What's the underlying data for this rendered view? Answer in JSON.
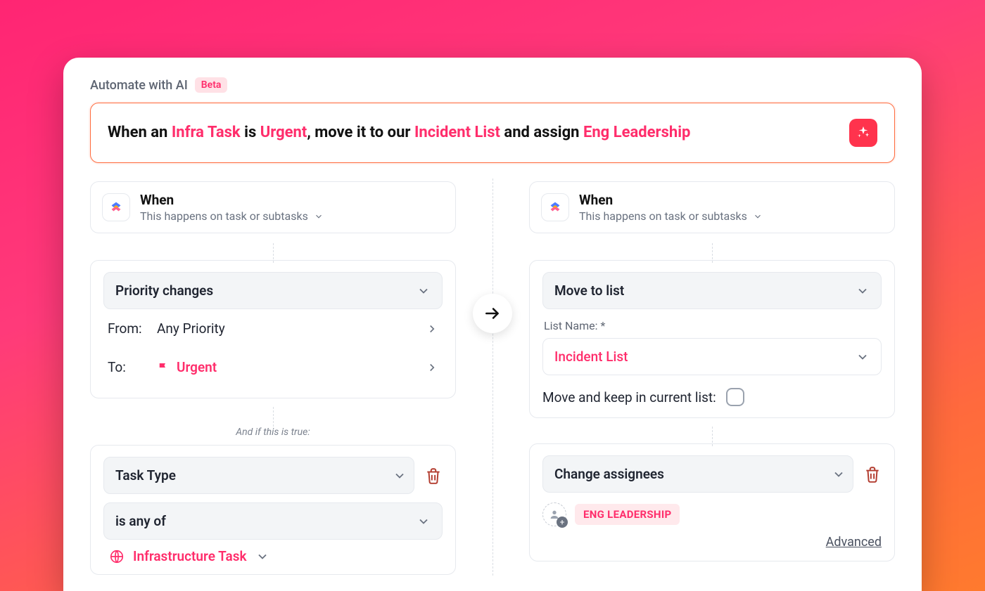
{
  "header": {
    "title": "Automate with AI",
    "badge": "Beta"
  },
  "prompt": {
    "p1": "When an ",
    "h1": "Infra Task",
    "p2": " is ",
    "h2": "Urgent",
    "p3": ", move it to our ",
    "h3": "Incident List",
    "p4": " and assign ",
    "h4": "Eng Leadership"
  },
  "when": {
    "title": "When",
    "sub": "This happens on task or subtasks"
  },
  "left": {
    "trigger": "Priority changes",
    "from_label": "From:",
    "from_value": "Any Priority",
    "to_label": "To:",
    "to_value": "Urgent",
    "cond_note": "And if this is true:",
    "cond_field": "Task Type",
    "cond_op": "is any of",
    "cond_value": "Infrastructure Task"
  },
  "right": {
    "action1": "Move to list",
    "listname_label": "List Name: *",
    "listname_value": "Incident List",
    "keep_label": "Move and keep in current list:",
    "action2": "Change assignees",
    "assignee_chip": "ENG LEADERSHIP",
    "advanced": "Advanced"
  }
}
